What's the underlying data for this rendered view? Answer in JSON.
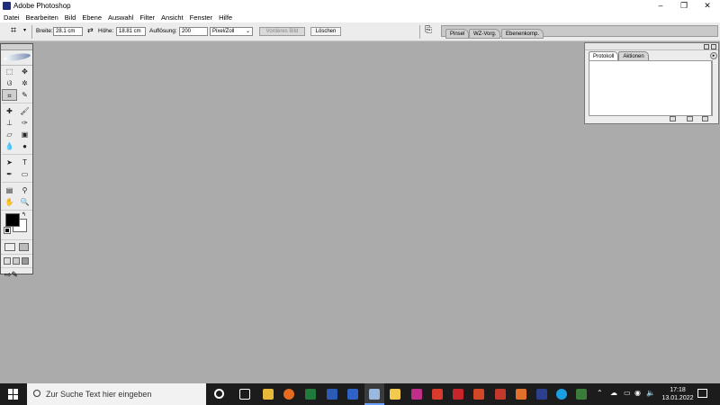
{
  "window": {
    "title": "Adobe Photoshop",
    "min": "–",
    "max": "❐",
    "close": "✕"
  },
  "menu": [
    "Datei",
    "Bearbeiten",
    "Bild",
    "Ebene",
    "Auswahl",
    "Filter",
    "Ansicht",
    "Fenster",
    "Hilfe"
  ],
  "options": {
    "width_label": "Breite:",
    "width_value": "28.1 cm",
    "height_label": "Höhe:",
    "height_value": "18.81 cm",
    "resolution_label": "Auflösung:",
    "resolution_value": "200",
    "unit_value": "Pixel/Zoll",
    "front_image_label": "Vorderes Bild",
    "clear_label": "Löschen",
    "well_tabs": [
      "Pinsel",
      "WZ-Vorg.",
      "Ebenenkomp."
    ]
  },
  "panel": {
    "tabs": [
      "Protokoll",
      "Aktionen"
    ]
  },
  "taskbar": {
    "search_placeholder": "Zur Suche Text hier eingeben",
    "time": "17:18",
    "date": "13.01.2022"
  },
  "colors": {
    "workspace": "#ababab",
    "taskbar": "#1c1c1c",
    "foreground": "#000000",
    "background": "#ffffff"
  }
}
